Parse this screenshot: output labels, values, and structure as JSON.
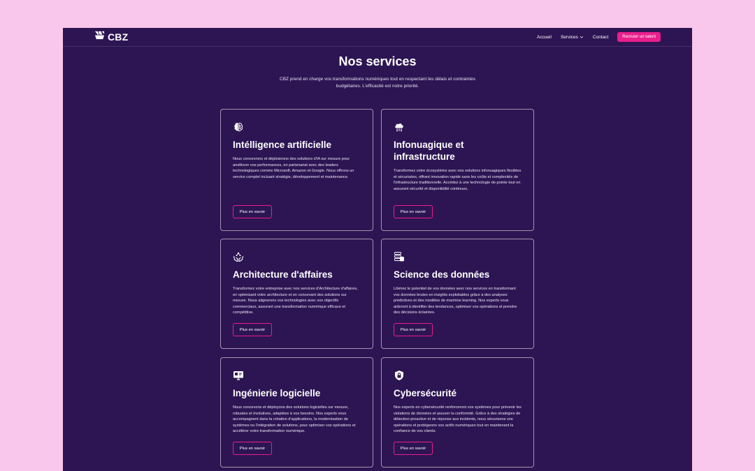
{
  "colors": {
    "background": "#f9c6ec",
    "panel": "#2d1553",
    "accent": "#e91e8c",
    "text": "#ffffff"
  },
  "header": {
    "logo_text": "CBZ",
    "logo_icon": "cbz-logo-icon",
    "nav": {
      "home": "Accueil",
      "services": "Services",
      "contact": "Contact"
    },
    "cta_label": "Recruter un talent"
  },
  "page": {
    "title": "Nos services",
    "subtitle": "CBZ prend en charge vos transformations numériques tout en respectant les délais et contraintes budgétaires. L'efficacité est notre priorité."
  },
  "services": [
    {
      "icon": "brain-icon",
      "title": "Intélligence artificielle",
      "description": "Nous concevrons et déploierons des solutions d'IA sur mesure pour améliorer vos performances, en partenariat avec des leaders technologiques comme Microsoft, Amazon et Google. Nous offrons un service complet incluant stratégie, développement et maintenance.",
      "button": "Plus en savoir"
    },
    {
      "icon": "cloud-icon",
      "title": "Infonuagique et infrastructure",
      "description": "Transformez votre écosystème avec nos solutions infonuagiques flexibles et sécurisées, offrant innovation rapide sans les coûts et complexités de l'infrastructure traditionnelle. Accédez à une technologie de pointe tout en assurant sécurité et disponibilité continues.",
      "button": "Plus en savoir"
    },
    {
      "icon": "hands-network-icon",
      "title": "Architecture d'affaires",
      "description": "Transformez votre entreprise avec nos services d'Architecture d'affaires, en optimisant votre architecture et en concevant des solutions sur mesure. Nous alignerons vos technologies avec vos objectifs commerciaux, assurant une transformation numérique efficace et compétitive.",
      "button": "Plus en savoir"
    },
    {
      "icon": "database-icon",
      "title": "Science des données",
      "description": "Libérez le potentiel de vos données avec nos services en transformant vos données brutes en insights exploitables grâce à des analyses prédictives et des modèles de machine learning. Nos experts vous aideront à identifier des tendances, optimiser vos opérations et prendre des décisions éclairées.",
      "button": "Plus en savoir"
    },
    {
      "icon": "monitor-code-icon",
      "title": "Ingénierie logicielle",
      "description": "Nous concevons et déployons des solutions logicielles sur mesure, robustes et évolutives, adaptées à vos besoins. Nos experts vous accompagnent dans la création d'applications, la modernisation de systèmes ou l'intégration de solutions, pour optimiser vos opérations et accélérer votre transformation numérique.",
      "button": "Plus en savoir"
    },
    {
      "icon": "shield-lock-icon",
      "title": "Cybersécurité",
      "description": "Nos experts en cybersécurité renforceront vos systèmes pour prévenir les violations de données et assurer la conformité. Grâce à des stratégies de détection proactive et de réponse aux incidents, nous sécurisons vos opérations et protégeons vos actifs numériques tout en maintenant la confiance de vos clients.",
      "button": "Plus en savoir"
    }
  ]
}
